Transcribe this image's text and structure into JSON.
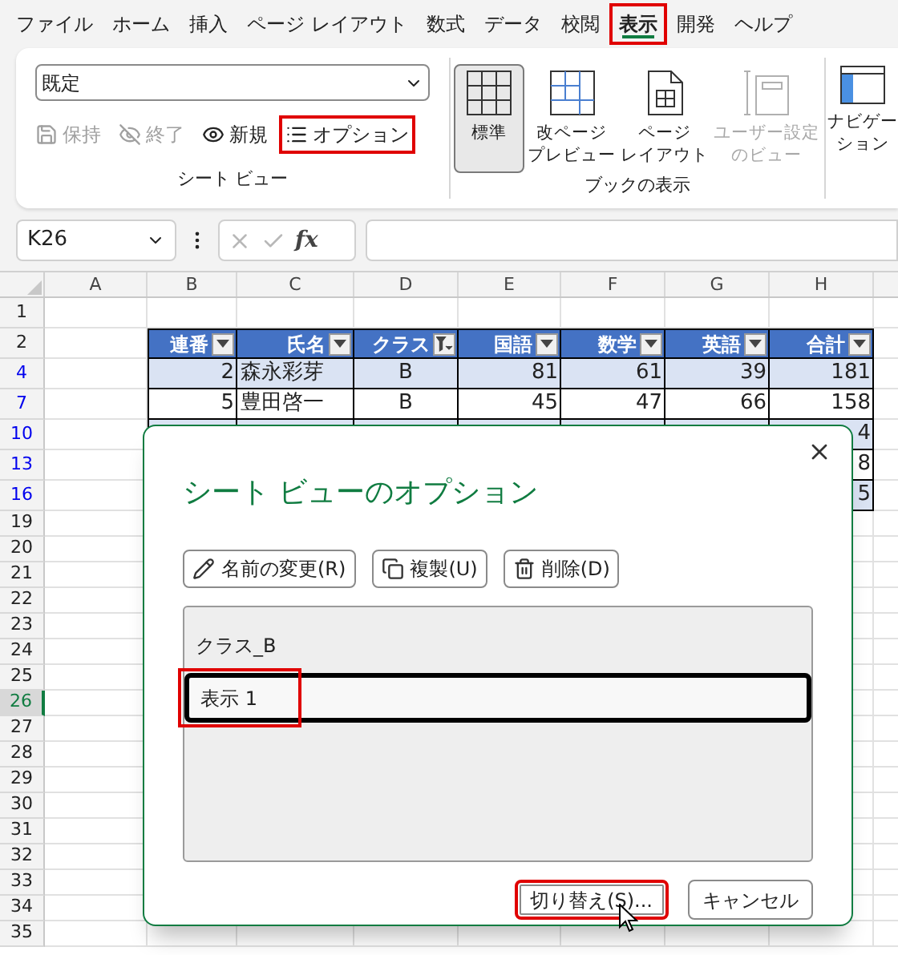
{
  "menu_tabs": [
    {
      "label": "ファイル",
      "selected": false,
      "highlighted": false
    },
    {
      "label": "ホーム",
      "selected": false,
      "highlighted": false
    },
    {
      "label": "挿入",
      "selected": false,
      "highlighted": false
    },
    {
      "label": "ページ レイアウト",
      "selected": false,
      "highlighted": false
    },
    {
      "label": "数式",
      "selected": false,
      "highlighted": false
    },
    {
      "label": "データ",
      "selected": false,
      "highlighted": false
    },
    {
      "label": "校閲",
      "selected": false,
      "highlighted": false
    },
    {
      "label": "表示",
      "selected": true,
      "highlighted": true
    },
    {
      "label": "開発",
      "selected": false,
      "highlighted": false
    },
    {
      "label": "ヘルプ",
      "selected": false,
      "highlighted": false
    }
  ],
  "ribbon": {
    "sheet_view": {
      "dropdown_value": "既定",
      "group_label": "シート ビュー",
      "buttons": [
        {
          "label": "保持",
          "kind": "save",
          "disabled": true,
          "highlighted": false
        },
        {
          "label": "終了",
          "kind": "exit",
          "disabled": true,
          "highlighted": false
        },
        {
          "label": "新規",
          "kind": "new",
          "disabled": false,
          "highlighted": false
        },
        {
          "label": "オプション",
          "kind": "options",
          "disabled": false,
          "highlighted": true
        }
      ]
    },
    "book_view": {
      "group_label": "ブックの表示",
      "buttons": [
        {
          "lines": [
            "標準"
          ],
          "kind": "normal",
          "selected": true,
          "disabled": false
        },
        {
          "lines": [
            "改ページ",
            "プレビュー"
          ],
          "kind": "page_break",
          "selected": false,
          "disabled": false
        },
        {
          "lines": [
            "ページ",
            "レイアウト"
          ],
          "kind": "page_layout",
          "selected": false,
          "disabled": false
        },
        {
          "lines": [
            "ユーザー設定",
            "のビュー"
          ],
          "kind": "custom_view",
          "selected": false,
          "disabled": true
        }
      ]
    },
    "navigation": {
      "lines": [
        "ナビゲー",
        "ション"
      ]
    }
  },
  "formula_bar": {
    "name_box": "K26",
    "function_button": "fx"
  },
  "sheet": {
    "columns": [
      "A",
      "B",
      "C",
      "D",
      "E",
      "F",
      "G",
      "H"
    ],
    "rows": [
      {
        "number": "1",
        "filtered": false,
        "selected": false,
        "kind": "plain"
      },
      {
        "number": "2",
        "filtered": false,
        "selected": false,
        "kind": "table_header",
        "cells": [
          {
            "label": "連番",
            "filter_active": false
          },
          {
            "label": "氏名",
            "filter_active": false
          },
          {
            "label": "クラス",
            "filter_active": true
          },
          {
            "label": "国語",
            "filter_active": false
          },
          {
            "label": "数学",
            "filter_active": false
          },
          {
            "label": "英語",
            "filter_active": false
          },
          {
            "label": "合計",
            "filter_active": false
          }
        ]
      },
      {
        "number": "4",
        "filtered": true,
        "selected": false,
        "kind": "table_row",
        "band": true,
        "cells": [
          "2",
          "森永彩芽",
          "B",
          "81",
          "61",
          "39",
          "181"
        ]
      },
      {
        "number": "7",
        "filtered": true,
        "selected": false,
        "kind": "table_row",
        "band": false,
        "cells": [
          "5",
          "豊田啓一",
          "B",
          "45",
          "47",
          "66",
          "158"
        ]
      },
      {
        "number": "10",
        "filtered": true,
        "selected": false,
        "kind": "table_row",
        "band": true,
        "cells": [
          null,
          null,
          null,
          null,
          null,
          null,
          "4"
        ]
      },
      {
        "number": "13",
        "filtered": true,
        "selected": false,
        "kind": "table_row",
        "band": false,
        "cells": [
          null,
          null,
          null,
          null,
          null,
          null,
          "8"
        ]
      },
      {
        "number": "16",
        "filtered": true,
        "selected": false,
        "kind": "table_row",
        "band": true,
        "cells": [
          null,
          null,
          null,
          null,
          null,
          null,
          "5"
        ]
      },
      {
        "number": "19",
        "filtered": false,
        "selected": false,
        "kind": "plain"
      },
      {
        "number": "20",
        "filtered": false,
        "selected": false,
        "kind": "plain"
      },
      {
        "number": "21",
        "filtered": false,
        "selected": false,
        "kind": "plain"
      },
      {
        "number": "22",
        "filtered": false,
        "selected": false,
        "kind": "plain"
      },
      {
        "number": "23",
        "filtered": false,
        "selected": false,
        "kind": "plain"
      },
      {
        "number": "24",
        "filtered": false,
        "selected": false,
        "kind": "plain"
      },
      {
        "number": "25",
        "filtered": false,
        "selected": false,
        "kind": "plain"
      },
      {
        "number": "26",
        "filtered": false,
        "selected": true,
        "kind": "plain"
      },
      {
        "number": "27",
        "filtered": false,
        "selected": false,
        "kind": "plain"
      },
      {
        "number": "28",
        "filtered": false,
        "selected": false,
        "kind": "plain"
      },
      {
        "number": "29",
        "filtered": false,
        "selected": false,
        "kind": "plain"
      },
      {
        "number": "30",
        "filtered": false,
        "selected": false,
        "kind": "plain"
      },
      {
        "number": "31",
        "filtered": false,
        "selected": false,
        "kind": "plain"
      },
      {
        "number": "32",
        "filtered": false,
        "selected": false,
        "kind": "plain"
      },
      {
        "number": "33",
        "filtered": false,
        "selected": false,
        "kind": "plain"
      },
      {
        "number": "34",
        "filtered": false,
        "selected": false,
        "kind": "plain"
      },
      {
        "number": "35",
        "filtered": false,
        "selected": false,
        "kind": "plain"
      }
    ]
  },
  "dialog": {
    "title": "シート ビューのオプション",
    "buttons": [
      {
        "label": "名前の変更(R)",
        "kind": "rename"
      },
      {
        "label": "複製(U)",
        "kind": "duplicate"
      },
      {
        "label": "削除(D)",
        "kind": "delete"
      }
    ],
    "list_items": [
      {
        "label": "クラス_B",
        "selected": false,
        "highlighted": false
      },
      {
        "label": "表示 1",
        "selected": true,
        "highlighted": true
      }
    ],
    "footer_buttons": [
      {
        "label": "切り替え(S)...",
        "highlighted": true
      },
      {
        "label": "キャンセル",
        "highlighted": false
      }
    ]
  }
}
